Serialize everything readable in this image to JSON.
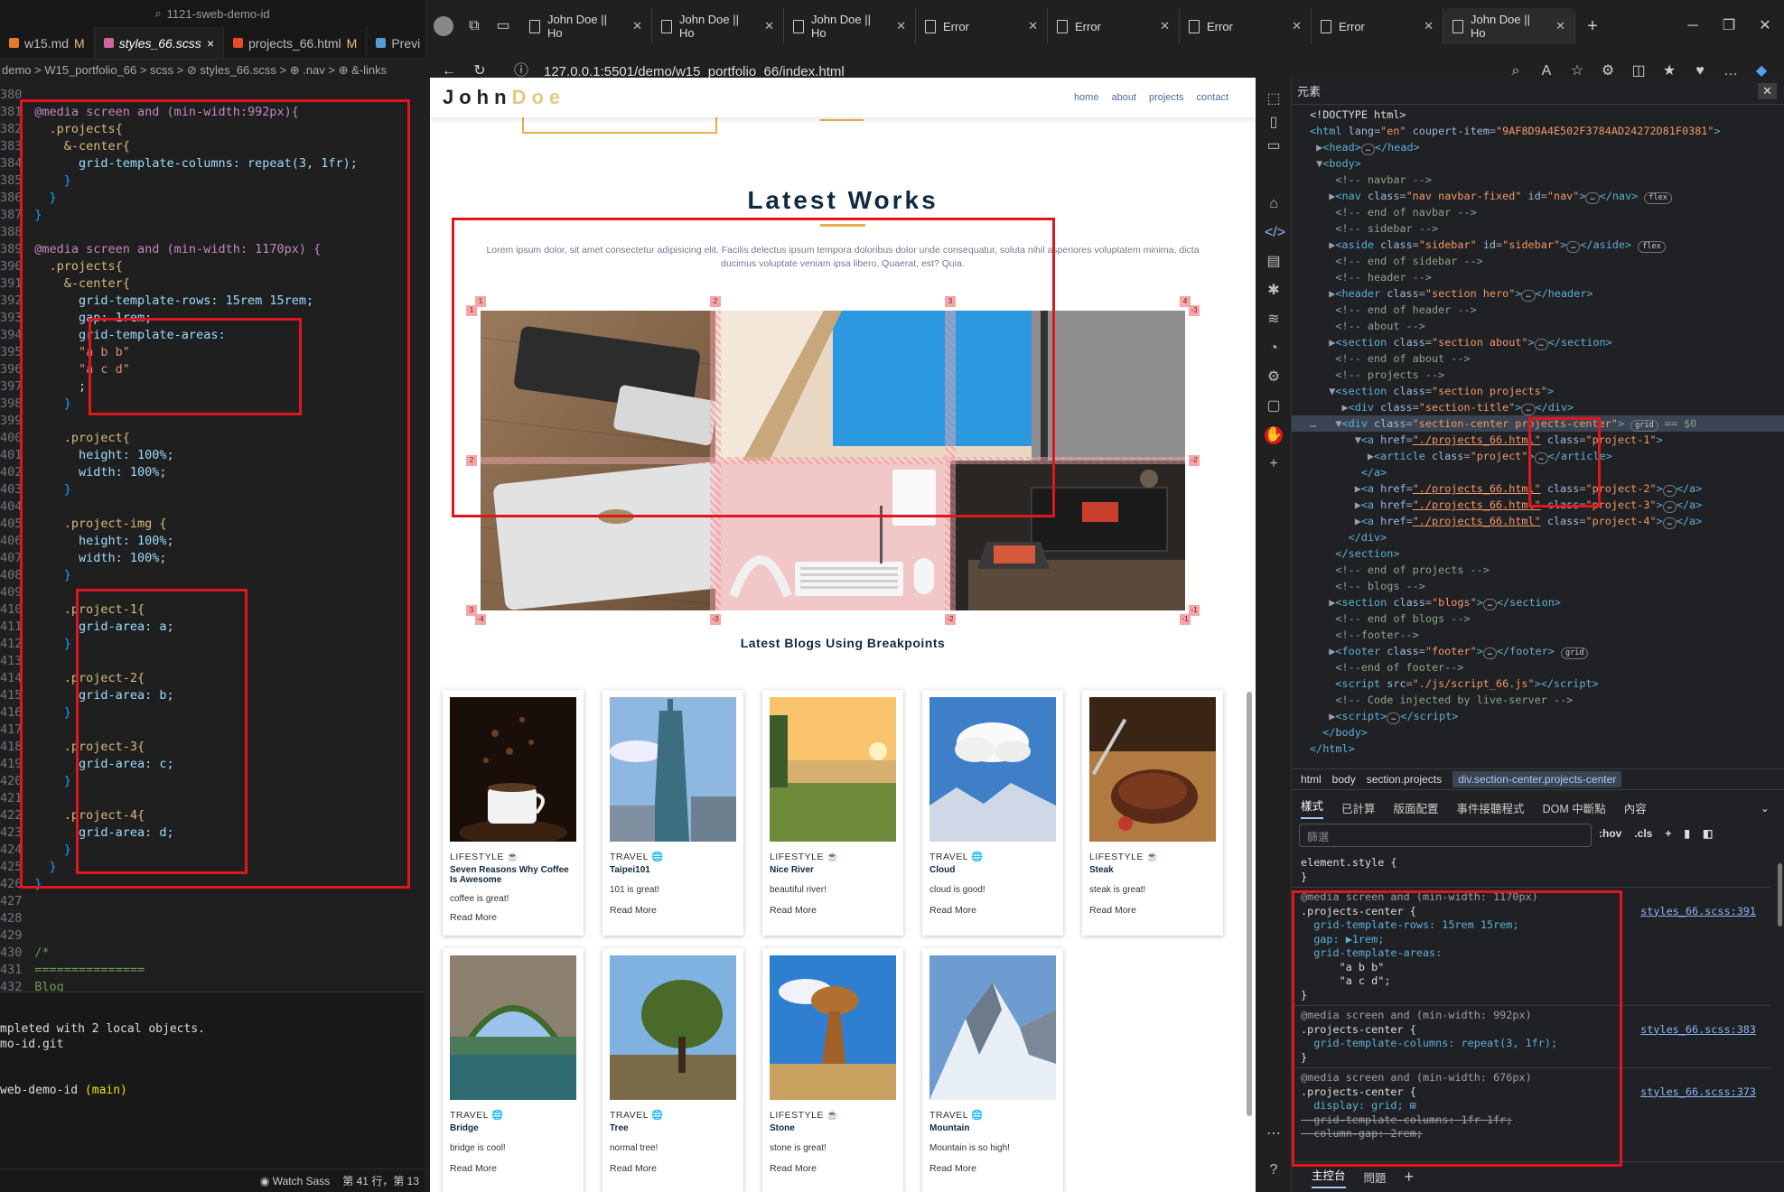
{
  "vscode": {
    "search": "1121-sweb-demo-id",
    "tabs": [
      {
        "label": "w15.md",
        "mark": "M"
      },
      {
        "label": "styles_66.scss",
        "mark": "×"
      },
      {
        "label": "projects_66.html",
        "mark": "M"
      },
      {
        "label": "Previ",
        "mark": ""
      }
    ],
    "breadcrumb": "demo > W15_portfolio_66 > scss > ⊘ styles_66.scss > ⊕ .nav > ⊕ &-links",
    "code": [
      {
        "n": "380",
        "t": ""
      },
      {
        "n": "381",
        "t": "  @media screen and (min-width:992px){"
      },
      {
        "n": "382",
        "t": "    .projects{"
      },
      {
        "n": "383",
        "t": "      &-center{"
      },
      {
        "n": "384",
        "t": "        grid-template-columns: repeat(3, 1fr);"
      },
      {
        "n": "385",
        "t": "      }"
      },
      {
        "n": "386",
        "t": "    }"
      },
      {
        "n": "387",
        "t": "  }"
      },
      {
        "n": "388",
        "t": ""
      },
      {
        "n": "389",
        "t": "  @media screen and (min-width: 1170px) {"
      },
      {
        "n": "390",
        "t": "    .projects{"
      },
      {
        "n": "391",
        "t": "      &-center{"
      },
      {
        "n": "392",
        "t": "        grid-template-rows: 15rem 15rem;"
      },
      {
        "n": "393",
        "t": "        gap: 1rem;"
      },
      {
        "n": "394",
        "t": "        grid-template-areas:"
      },
      {
        "n": "395",
        "t": "        \"a b b\""
      },
      {
        "n": "396",
        "t": "        \"a c d\""
      },
      {
        "n": "397",
        "t": "        ;"
      },
      {
        "n": "398",
        "t": "      }"
      },
      {
        "n": "399",
        "t": ""
      },
      {
        "n": "400",
        "t": "      .project{"
      },
      {
        "n": "401",
        "t": "        height: 100%;"
      },
      {
        "n": "402",
        "t": "        width: 100%;"
      },
      {
        "n": "403",
        "t": "      }"
      },
      {
        "n": "404",
        "t": ""
      },
      {
        "n": "405",
        "t": "      .project-img {"
      },
      {
        "n": "406",
        "t": "        height: 100%;"
      },
      {
        "n": "407",
        "t": "        width: 100%;"
      },
      {
        "n": "408",
        "t": "      }"
      },
      {
        "n": "409",
        "t": ""
      },
      {
        "n": "410",
        "t": "      .project-1{"
      },
      {
        "n": "411",
        "t": "        grid-area: a;"
      },
      {
        "n": "412",
        "t": "      }"
      },
      {
        "n": "413",
        "t": ""
      },
      {
        "n": "414",
        "t": "      .project-2{"
      },
      {
        "n": "415",
        "t": "        grid-area: b;"
      },
      {
        "n": "416",
        "t": "      }"
      },
      {
        "n": "417",
        "t": ""
      },
      {
        "n": "418",
        "t": "      .project-3{"
      },
      {
        "n": "419",
        "t": "        grid-area: c;"
      },
      {
        "n": "420",
        "t": "      }"
      },
      {
        "n": "421",
        "t": ""
      },
      {
        "n": "422",
        "t": "      .project-4{"
      },
      {
        "n": "423",
        "t": "        grid-area: d;"
      },
      {
        "n": "424",
        "t": "      }"
      },
      {
        "n": "425",
        "t": "    }"
      },
      {
        "n": "426",
        "t": "  }"
      },
      {
        "n": "427",
        "t": ""
      },
      {
        "n": "428",
        "t": ""
      },
      {
        "n": "429",
        "t": ""
      },
      {
        "n": "430",
        "t": "  /*"
      },
      {
        "n": "431",
        "t": "  ==============="
      },
      {
        "n": "432",
        "t": "  Blog"
      }
    ],
    "terminal": [
      {
        "t": "mpleted with 2 local objects.",
        "g": ""
      },
      {
        "t": "mo-id.git",
        "g": ""
      },
      {
        "t": "",
        "g": ""
      },
      {
        "t": "",
        "g": ""
      },
      {
        "t": "web-demo-id ",
        "g": "(main)"
      }
    ],
    "status": {
      "watch": "Watch Sass",
      "pos": "第 41 行，第 13"
    }
  },
  "browser": {
    "tabs": [
      {
        "label": "John Doe || Ho",
        "active": false
      },
      {
        "label": "John Doe || Ho",
        "active": false
      },
      {
        "label": "John Doe || Ho",
        "active": false
      },
      {
        "label": "Error",
        "active": false
      },
      {
        "label": "Error",
        "active": false
      },
      {
        "label": "Error",
        "active": false
      },
      {
        "label": "Error",
        "active": false
      },
      {
        "label": "John Doe || Ho",
        "active": true
      }
    ],
    "url": "127.0.0.1:5501/demo/w15_portfolio_66/index.html"
  },
  "site": {
    "logo_a": "John",
    "logo_b": "Doe",
    "nav": [
      "home",
      "about",
      "projects",
      "contact"
    ],
    "projects_title": "Latest Works",
    "projects_desc": "Lorem ipsum dolor, sit amet consectetur adipisicing elit. Facilis delectus ipsum tempora doloribus dolor unde consequatur, soluta nihil asperiores voluptatem minima, dicta ducimus voluptate veniam ipsa libero. Quaerat, est? Quia.",
    "grid_labels": {
      "top": [
        "1",
        "2",
        "3",
        "4"
      ],
      "left": [
        "1",
        "2",
        "3"
      ],
      "right": [
        "-3",
        "-2",
        "-1"
      ],
      "bottom": [
        "-4",
        "-3",
        "-2",
        "-1"
      ]
    },
    "blogs_title": "Latest Blogs Using Breakpoints",
    "blogs": [
      {
        "cat": "LIFESTYLE ☕",
        "title": "Seven Reasons Why Coffee Is Awesome",
        "text": "coffee is great!",
        "more": "Read More",
        "img": "coffee"
      },
      {
        "cat": "TRAVEL 🌐",
        "title": "Taipei101",
        "text": "101 is great!",
        "more": "Read More",
        "img": "taipei"
      },
      {
        "cat": "LIFESTYLE ☕",
        "title": "Nice River",
        "text": "beautiful river!",
        "more": "Read More",
        "img": "river"
      },
      {
        "cat": "TRAVEL 🌐",
        "title": "Cloud",
        "text": "cloud is good!",
        "more": "Read More",
        "img": "cloud"
      },
      {
        "cat": "LIFESTYLE ☕",
        "title": "Steak",
        "text": "steak is great!",
        "more": "Read More",
        "img": "steak"
      },
      {
        "cat": "TRAVEL 🌐",
        "title": "Bridge",
        "text": "bridge is cool!",
        "more": "Read More",
        "img": "bridge"
      },
      {
        "cat": "TRAVEL 🌐",
        "title": "Tree",
        "text": "normal tree!",
        "more": "Read More",
        "img": "tree"
      },
      {
        "cat": "LIFESTYLE ☕",
        "title": "Stone",
        "text": "stone is great!",
        "more": "Read More",
        "img": "stone"
      },
      {
        "cat": "TRAVEL 🌐",
        "title": "Mountain",
        "text": "Mountain is so high!",
        "more": "Read More",
        "img": "mountain"
      }
    ]
  },
  "devtools": {
    "panel_title": "元素",
    "breadcrumbs": [
      "html",
      "body",
      "section.projects",
      "div.section-center.projects-center"
    ],
    "panel_tabs": [
      "樣式",
      "已計算",
      "版面配置",
      "事件接聽程式",
      "DOM 中斷點",
      "內容"
    ],
    "filter_placeholder": "篩選",
    "filter_tools": [
      ":hov",
      ".cls"
    ],
    "bottom_tabs": [
      "主控台",
      "問題"
    ],
    "styles": [
      {
        "k": "plain",
        "t": "element.style {"
      },
      {
        "k": "plain",
        "t": "}"
      },
      {
        "k": "sep",
        "t": ""
      },
      {
        "k": "media",
        "t": "@media screen and (min-width: 1170px)"
      },
      {
        "k": "rule",
        "t": ".projects-center {",
        "link": "styles_66.scss:391"
      },
      {
        "k": "decl",
        "t": "  grid-template-rows: 15rem 15rem;"
      },
      {
        "k": "decl",
        "t": "  gap: ▶1rem;"
      },
      {
        "k": "decl",
        "t": "  grid-template-areas:"
      },
      {
        "k": "plain",
        "t": "      \"a b b\""
      },
      {
        "k": "plain",
        "t": "      \"a c d\";"
      },
      {
        "k": "plain",
        "t": "}"
      },
      {
        "k": "sep",
        "t": ""
      },
      {
        "k": "media",
        "t": "@media screen and (min-width: 992px)"
      },
      {
        "k": "rule",
        "t": ".projects-center {",
        "link": "styles_66.scss:383"
      },
      {
        "k": "decl",
        "t": "  grid-template-columns: repeat(3, 1fr);"
      },
      {
        "k": "plain",
        "t": "}"
      },
      {
        "k": "sep",
        "t": ""
      },
      {
        "k": "media",
        "t": "@media screen and (min-width: 676px)"
      },
      {
        "k": "rule",
        "t": ".projects-center {",
        "link": "styles_66.scss:373"
      },
      {
        "k": "decl",
        "t": "  display: grid; ⊞"
      },
      {
        "k": "strike",
        "t": "  grid-template-columns: 1fr 1fr;"
      },
      {
        "k": "strike",
        "t": "  column-gap: 2rem;"
      }
    ]
  }
}
